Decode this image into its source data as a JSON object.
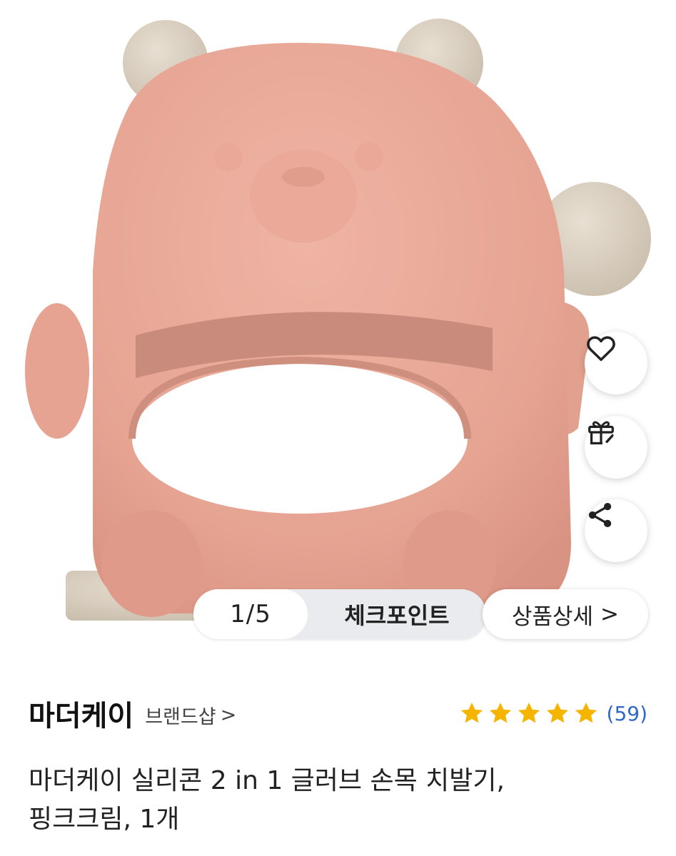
{
  "gallery": {
    "counter": "1/5",
    "checkpoint_label": "체크포인트",
    "detail_label": "상품상세",
    "detail_chevron": ">"
  },
  "actions": {
    "like_icon": "heart-icon",
    "gift_icon": "gift-icon",
    "share_icon": "share-icon"
  },
  "brand": {
    "name": "마더케이",
    "shop_label": "브랜드샵",
    "shop_chevron": ">"
  },
  "rating": {
    "stars": 5,
    "review_count": "(59)",
    "star_color": "#f5b400"
  },
  "product": {
    "title_line1": "마더케이 실리콘 2 in 1 글러브 손목 치발기,",
    "title_line2": "핑크크림, 1개"
  },
  "colors": {
    "product_pink": "#e8a898",
    "product_cream": "#ddd3c4",
    "link_blue": "#2f67c9"
  }
}
